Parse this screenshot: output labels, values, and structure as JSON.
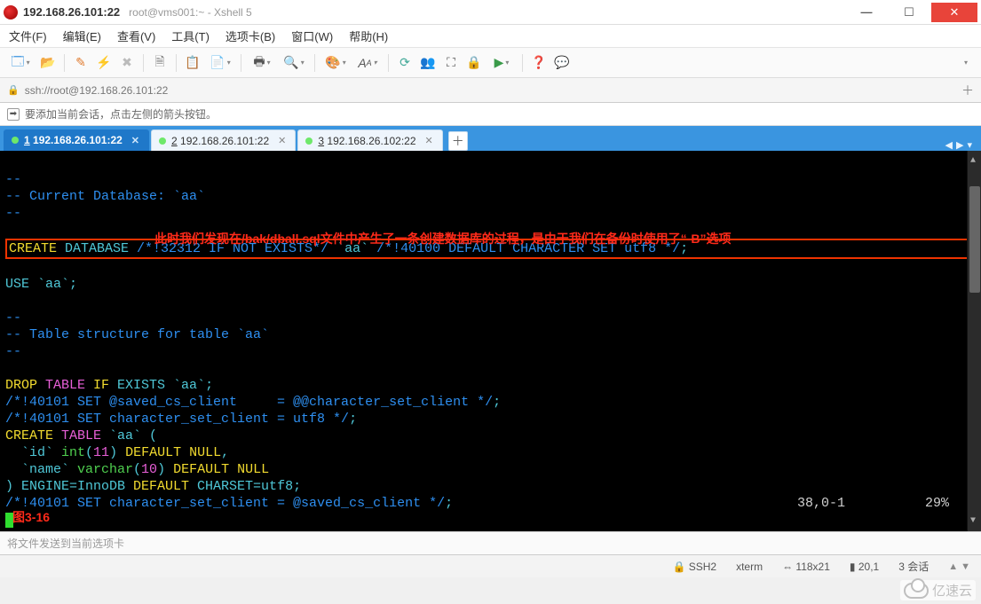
{
  "title": {
    "ip": "192.168.26.101:22",
    "sub": "root@vms001:~ - Xshell 5"
  },
  "menu": {
    "file": "文件(F)",
    "edit": "编辑(E)",
    "view": "查看(V)",
    "tools": "工具(T)",
    "tabs": "选项卡(B)",
    "window": "窗口(W)",
    "help": "帮助(H)"
  },
  "address": {
    "url": "ssh://root@192.168.26.101:22"
  },
  "hint": {
    "text": "要添加当前会话，点击左侧的箭头按钮。"
  },
  "tabs": [
    {
      "num": "1",
      "label": "192.168.26.101:22",
      "active": true
    },
    {
      "num": "2",
      "label": "192.168.26.101:22",
      "active": false
    },
    {
      "num": "3",
      "label": "192.168.26.102:22",
      "active": false
    }
  ],
  "terminal": {
    "line_dashes": "--",
    "line_curdb": "-- Current Database: `aa`",
    "boxed_part1": "CREATE",
    "boxed_part2": " DATABASE ",
    "boxed_part3": "/*!32312 IF NOT EXISTS*/",
    "boxed_part4": " `aa` ",
    "boxed_part5": "/*!40100 DEFAULT CHARACTER SET utf8 */",
    "boxed_part6": ";",
    "annotation": "此时我们发现在/bak/dball.sql文件中产生了一条创建数据库的过程，是由于我们在备份时使用了“-B”选项",
    "use_aa": "USE `aa`;",
    "tbl_struct": "-- Table structure for table `aa`",
    "drop_1": "DROP",
    "drop_2": " TABLE ",
    "drop_3": "IF",
    "drop_4": " EXISTS `aa`;",
    "set1_a": "/*!40101 SET @saved_cs_client     = @@character_set_client */",
    "set1_b": ";",
    "set2_a": "/*!40101 SET character_set_client = utf8 */",
    "set2_b": ";",
    "create_1": "CREATE",
    "create_2": " TABLE ",
    "create_3": "`aa`",
    "create_4": " (",
    "col_id_a": "  `id` ",
    "col_id_b": "int",
    "col_id_c": "(",
    "col_id_d": "11",
    "col_id_e": ") ",
    "col_id_f": "DEFAULT NULL",
    "col_id_g": ",",
    "col_nm_a": "  `name` ",
    "col_nm_b": "varchar",
    "col_nm_c": "(",
    "col_nm_d": "10",
    "col_nm_e": ") ",
    "col_nm_f": "DEFAULT NULL",
    "eng_a": ") ENGINE=InnoDB ",
    "eng_b": "DEFAULT",
    "eng_c": " CHARSET=utf8;",
    "set3_a": "/*!40101 SET character_set_client = @saved_cs_client */",
    "set3_b": ";",
    "status_pos": "38,0-1",
    "status_pct": "29%",
    "caption": "图3-16"
  },
  "cmdbar": {
    "hint": "将文件发送到当前选项卡"
  },
  "status": {
    "protocol": "SSH2",
    "termtype": "xterm",
    "size": "118x21",
    "cursor": "20,1",
    "sessions": "3 会话"
  },
  "watermark": {
    "text": "亿速云"
  }
}
